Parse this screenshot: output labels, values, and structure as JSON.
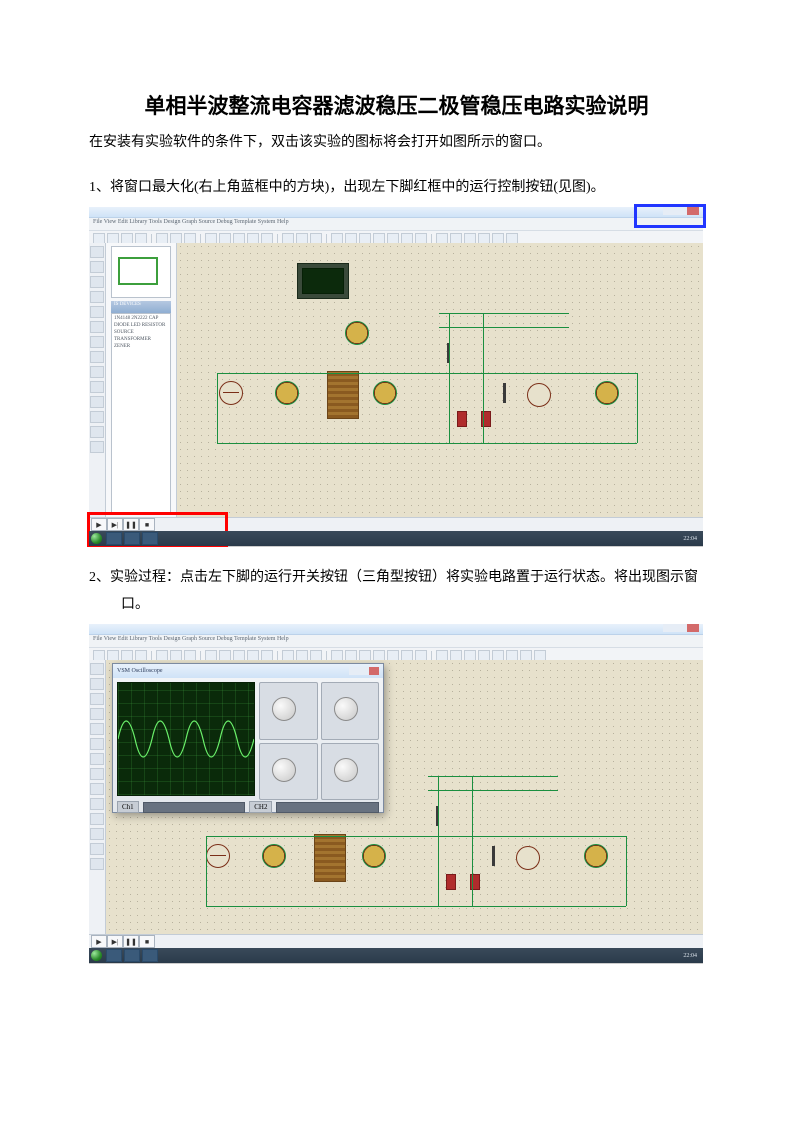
{
  "title": "单相半波整流电容器滤波稳压二极管稳压电路实验说明",
  "intro": "在安装有实验软件的条件下，双击该实验的图标将会打开如图所示的窗口。",
  "step1": "1、将窗口最大化(右上角蓝框中的方块)，出现左下脚红框中的运行控制按钮(见图)。",
  "step2": "2、实验过程：点击左下脚的运行开关按钮（三角型按钮）将实验电路置于运行状态。将出现图示窗口。",
  "sim": {
    "menu_items": "File  View  Edit  Library  Tools  Design  Graph  Source  Debug  Template  System  Help",
    "devices_header": "IS  DEVICES",
    "device_list": "1N4148\n2N2222\nCAP\nDIODE\nLED\nRESISTOR\nSOURCE\nTRANSFORMER\nZENER",
    "clock": "22:04",
    "osc_title": "VSM Oscilloscope",
    "ch1": "Ch1",
    "ch2": "CH2"
  }
}
